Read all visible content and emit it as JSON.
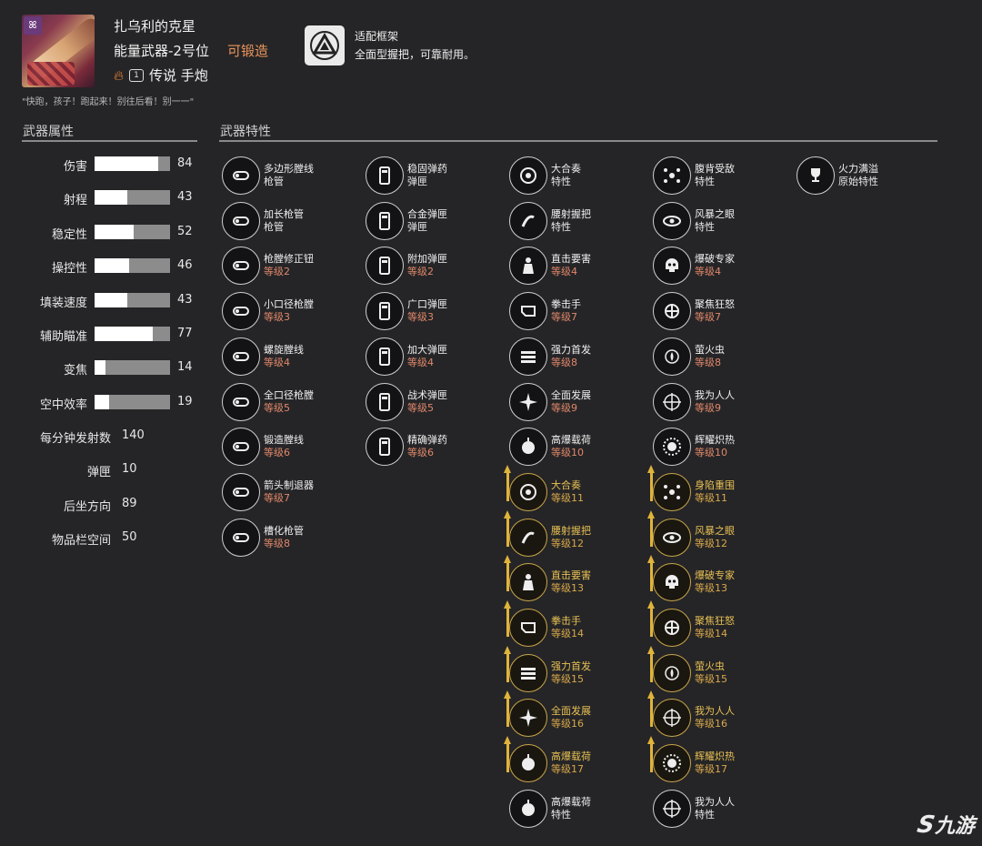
{
  "weapon": {
    "name": "扎乌利的克星",
    "type": "能量武器-2号位",
    "forgeable": "可锻造",
    "rarity_level": "1",
    "rarity": "传说 手炮",
    "quote": "\"快跑，孩子！跑起来！别往后看！别一一\"",
    "accent_color": "#e8935a"
  },
  "frame": {
    "title": "适配框架",
    "desc": "全面型握把，可靠耐用。",
    "icon": "frame-triangle-icon"
  },
  "stats_section": {
    "title": "武器属性",
    "bars": [
      {
        "label": "伤害",
        "value": 84
      },
      {
        "label": "射程",
        "value": 43
      },
      {
        "label": "稳定性",
        "value": 52
      },
      {
        "label": "操控性",
        "value": 46
      },
      {
        "label": "填装速度",
        "value": 43
      },
      {
        "label": "辅助瞄准",
        "value": 77
      },
      {
        "label": "变焦",
        "value": 14
      },
      {
        "label": "空中效率",
        "value": 19
      }
    ],
    "numbers": [
      {
        "label": "每分钟发射数",
        "value": "140"
      },
      {
        "label": "弹匣",
        "value": "10"
      },
      {
        "label": "后坐方向",
        "value": "89"
      },
      {
        "label": "物品栏空间",
        "value": "50"
      }
    ]
  },
  "perks_section": {
    "title": "武器特性",
    "columns": [
      [
        {
          "name": "多边形膛线",
          "sub": "枪管",
          "icon": "barrel-icon"
        },
        {
          "name": "加长枪管",
          "sub": "枪管",
          "icon": "barrel-icon"
        },
        {
          "name": "枪膛修正钮",
          "sub": "等级2",
          "icon": "barrel-icon"
        },
        {
          "name": "小口径枪膛",
          "sub": "等级3",
          "icon": "barrel-icon"
        },
        {
          "name": "螺旋膛线",
          "sub": "等级4",
          "icon": "barrel-icon"
        },
        {
          "name": "全口径枪膛",
          "sub": "等级5",
          "icon": "barrel-icon"
        },
        {
          "name": "锻造膛线",
          "sub": "等级6",
          "icon": "barrel-icon"
        },
        {
          "name": "箭头制退器",
          "sub": "等级7",
          "icon": "barrel-icon"
        },
        {
          "name": "槽化枪管",
          "sub": "等级8",
          "icon": "barrel-icon"
        }
      ],
      [
        {
          "name": "稳固弹药",
          "sub": "弹匣",
          "icon": "magazine-icon"
        },
        {
          "name": "合金弹匣",
          "sub": "弹匣",
          "icon": "magazine-icon"
        },
        {
          "name": "附加弹匣",
          "sub": "等级2",
          "icon": "magazine-icon"
        },
        {
          "name": "广口弹匣",
          "sub": "等级3",
          "icon": "magazine-icon"
        },
        {
          "name": "加大弹匣",
          "sub": "等级4",
          "icon": "magazine-icon"
        },
        {
          "name": "战术弹匣",
          "sub": "等级5",
          "icon": "magazine-icon"
        },
        {
          "name": "精确弹药",
          "sub": "等级6",
          "icon": "magazine-icon"
        }
      ],
      [
        {
          "name": "大合奏",
          "sub": "特性",
          "icon": "ensemble-icon"
        },
        {
          "name": "腰射握把",
          "sub": "特性",
          "icon": "grip-icon"
        },
        {
          "name": "直击要害",
          "sub": "等级4",
          "icon": "target-body-icon"
        },
        {
          "name": "拳击手",
          "sub": "等级7",
          "icon": "fist-icon"
        },
        {
          "name": "强力首发",
          "sub": "等级8",
          "icon": "bullets-icon"
        },
        {
          "name": "全面发展",
          "sub": "等级9",
          "icon": "burst-icon"
        },
        {
          "name": "高爆载荷",
          "sub": "等级10",
          "icon": "explosive-icon"
        },
        {
          "name": "大合奏",
          "sub": "等级11",
          "icon": "ensemble-icon",
          "gold": true
        },
        {
          "name": "腰射握把",
          "sub": "等级12",
          "icon": "grip-icon",
          "gold": true
        },
        {
          "name": "直击要害",
          "sub": "等级13",
          "icon": "target-body-icon",
          "gold": true
        },
        {
          "name": "拳击手",
          "sub": "等级14",
          "icon": "fist-icon",
          "gold": true
        },
        {
          "name": "强力首发",
          "sub": "等级15",
          "icon": "bullets-icon",
          "gold": true
        },
        {
          "name": "全面发展",
          "sub": "等级16",
          "icon": "burst-icon",
          "gold": true
        },
        {
          "name": "高爆载荷",
          "sub": "等级17",
          "icon": "explosive-icon",
          "gold": true
        },
        {
          "name": "高爆载荷",
          "sub": "特性",
          "icon": "explosive-icon"
        }
      ],
      [
        {
          "name": "腹背受敌",
          "sub": "特性",
          "icon": "surrounded-icon"
        },
        {
          "name": "风暴之眼",
          "sub": "特性",
          "icon": "storm-eye-icon"
        },
        {
          "name": "爆破专家",
          "sub": "等级4",
          "icon": "skull-icon"
        },
        {
          "name": "聚焦狂怒",
          "sub": "等级7",
          "icon": "fury-icon"
        },
        {
          "name": "萤火虫",
          "sub": "等级8",
          "icon": "firefly-icon"
        },
        {
          "name": "我为人人",
          "sub": "等级9",
          "icon": "crosshair-icon"
        },
        {
          "name": "辉耀炽热",
          "sub": "等级10",
          "icon": "radiant-icon"
        },
        {
          "name": "身陷重围",
          "sub": "等级11",
          "icon": "surrounded-icon",
          "gold": true
        },
        {
          "name": "风暴之眼",
          "sub": "等级12",
          "icon": "storm-eye-icon",
          "gold": true
        },
        {
          "name": "爆破专家",
          "sub": "等级13",
          "icon": "skull-icon",
          "gold": true
        },
        {
          "name": "聚焦狂怒",
          "sub": "等级14",
          "icon": "fury-icon",
          "gold": true
        },
        {
          "name": "萤火虫",
          "sub": "等级15",
          "icon": "firefly-icon",
          "gold": true
        },
        {
          "name": "我为人人",
          "sub": "等级16",
          "icon": "crosshair-icon",
          "gold": true
        },
        {
          "name": "辉耀炽热",
          "sub": "等级17",
          "icon": "radiant-icon",
          "gold": true
        },
        {
          "name": "我为人人",
          "sub": "特性",
          "icon": "crosshair-icon"
        }
      ],
      [
        {
          "name": "火力满溢",
          "sub": "原始特性",
          "icon": "trophy-icon"
        }
      ]
    ]
  },
  "watermark": {
    "logo": "九游"
  }
}
